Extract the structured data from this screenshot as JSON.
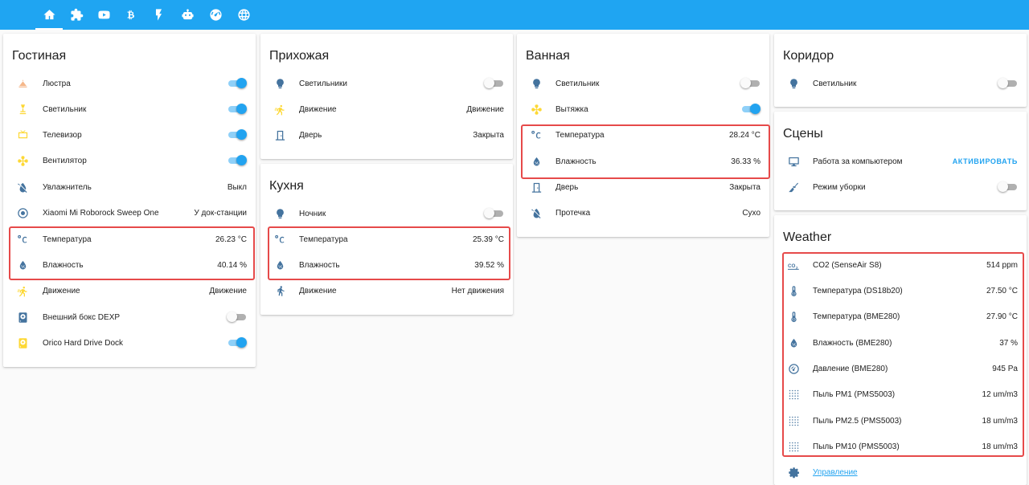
{
  "tabs": [
    {
      "icon": "home-icon",
      "active": true
    },
    {
      "icon": "puzzle-icon"
    },
    {
      "icon": "youtube-icon"
    },
    {
      "icon": "bitcoin-icon"
    },
    {
      "icon": "flash-icon"
    },
    {
      "icon": "robot-icon"
    },
    {
      "icon": "speedometer-icon"
    },
    {
      "icon": "globe-icon"
    }
  ],
  "colors": {
    "accent": "#1fa5f2",
    "icon_blue": "#44739e",
    "icon_yellow": "#fdd835",
    "highlight": "#e64a4a"
  },
  "cards": {
    "living": {
      "title": "Гостиная",
      "rows": [
        {
          "icon": "chandelier-icon",
          "label": "Люстра",
          "toggle": true
        },
        {
          "icon": "lamp-icon",
          "label": "Светильник",
          "toggle": true
        },
        {
          "icon": "tv-icon",
          "label": "Телевизор",
          "toggle": true
        },
        {
          "icon": "fan-icon",
          "label": "Вентилятор",
          "toggle": true
        },
        {
          "icon": "humidifier-off-icon",
          "label": "Увлажнитель",
          "value": "Выкл"
        },
        {
          "icon": "robot-vacuum-icon",
          "label": "Xiaomi Mi Roborock Sweep One",
          "value": "У док-станции"
        },
        {
          "icon": "temperature-celsius-icon",
          "label": "Температура",
          "value": "26.23 °C"
        },
        {
          "icon": "water-percent-icon",
          "label": "Влажность",
          "value": "40.14 %"
        },
        {
          "icon": "motion-icon",
          "label": "Движение",
          "value": "Движение"
        },
        {
          "icon": "harddisk-icon",
          "label": "Внешний бокс DEXP",
          "toggle": false
        },
        {
          "icon": "harddisk-yellow-icon",
          "label": "Orico Hard Drive Dock",
          "toggle": true
        }
      ]
    },
    "hallway": {
      "title": "Прихожая",
      "rows": [
        {
          "icon": "bulb-icon",
          "label": "Светильники",
          "toggle": false
        },
        {
          "icon": "motion-icon",
          "label": "Движение",
          "value": "Движение"
        },
        {
          "icon": "door-icon",
          "label": "Дверь",
          "value": "Закрыта"
        }
      ]
    },
    "kitchen": {
      "title": "Кухня",
      "rows": [
        {
          "icon": "bulb-icon",
          "label": "Ночник",
          "toggle": false
        },
        {
          "icon": "temperature-celsius-icon",
          "label": "Температура",
          "value": "25.39 °C"
        },
        {
          "icon": "water-percent-icon",
          "label": "Влажность",
          "value": "39.52 %"
        },
        {
          "icon": "walk-icon",
          "label": "Движение",
          "value": "Нет движения"
        }
      ]
    },
    "bathroom": {
      "title": "Ванная",
      "rows": [
        {
          "icon": "bulb-icon",
          "label": "Светильник",
          "toggle": false
        },
        {
          "icon": "fan-icon",
          "label": "Вытяжка",
          "toggle": true
        },
        {
          "icon": "temperature-celsius-icon",
          "label": "Температура",
          "value": "28.24 °C"
        },
        {
          "icon": "water-percent-icon",
          "label": "Влажность",
          "value": "36.33 %"
        },
        {
          "icon": "door-icon",
          "label": "Дверь",
          "value": "Закрыта"
        },
        {
          "icon": "leak-off-icon",
          "label": "Протечка",
          "value": "Сухо"
        }
      ]
    },
    "corridor": {
      "title": "Коридор",
      "rows": [
        {
          "icon": "bulb-icon",
          "label": "Светильник",
          "toggle": false
        }
      ]
    },
    "scenes": {
      "title": "Сцены",
      "rows": [
        {
          "icon": "monitor-icon",
          "label": "Работа за компьютером",
          "action": "АКТИВИРОВАТЬ"
        },
        {
          "icon": "broom-icon",
          "label": "Режим уборки",
          "toggle": false
        }
      ]
    },
    "weather": {
      "title": "Weather",
      "rows": [
        {
          "icon": "co2-icon",
          "label": "CO2 (SenseAir S8)",
          "value": "514 ppm"
        },
        {
          "icon": "thermometer-icon",
          "label": "Температура (DS18b20)",
          "value": "27.50 °C"
        },
        {
          "icon": "thermometer-icon",
          "label": "Температура (BME280)",
          "value": "27.90 °C"
        },
        {
          "icon": "water-percent-icon",
          "label": "Влажность (BME280)",
          "value": "37 %"
        },
        {
          "icon": "gauge-icon",
          "label": "Давление (BME280)",
          "value": "945 Pa"
        },
        {
          "icon": "dots-grid-icon",
          "label": "Пыль PM1 (PMS5003)",
          "value": "12 um/m3"
        },
        {
          "icon": "dots-grid-icon",
          "label": "Пыль PM2.5 (PMS5003)",
          "value": "18 um/m3"
        },
        {
          "icon": "dots-grid-icon",
          "label": "Пыль PM10 (PMS5003)",
          "value": "18 um/m3"
        }
      ],
      "footer_icon": "gear-icon",
      "footer_link": "Управление"
    }
  }
}
